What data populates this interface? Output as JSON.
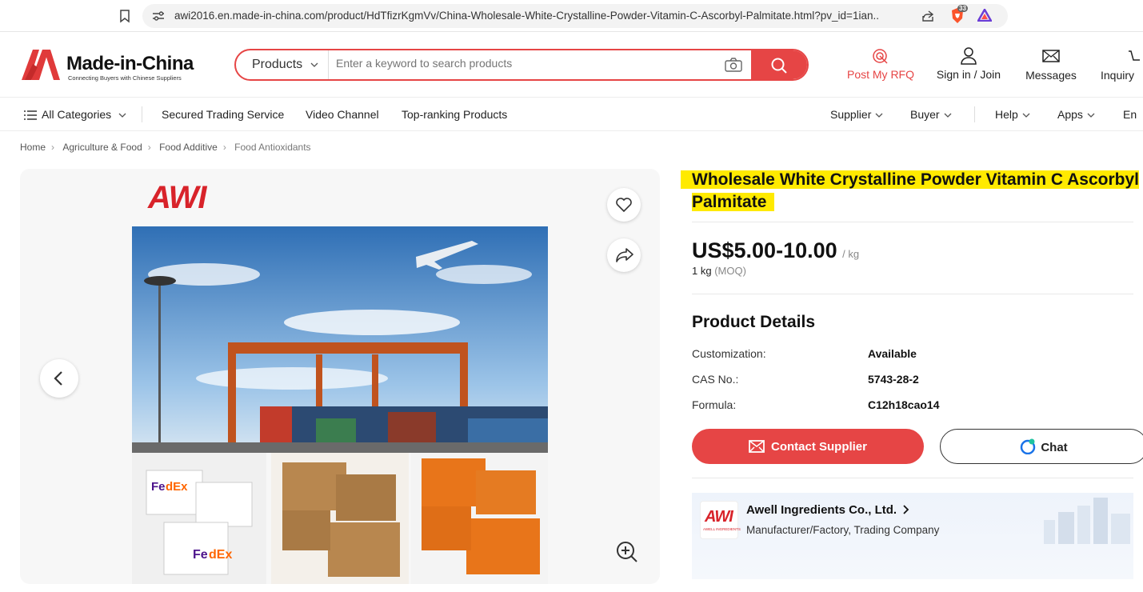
{
  "browser": {
    "url": "awi2016.en.made-in-china.com/product/HdTfizrKgmVv/China-Wholesale-White-Crystalline-Powder-Vitamin-C-Ascorbyl-Palmitate.html?pv_id=1ian...",
    "extension_badge": "33"
  },
  "header": {
    "logo_text": "Made-in-China",
    "logo_tagline": "Connecting Buyers with Chinese Suppliers",
    "search_category": "Products",
    "search_placeholder": "Enter a keyword to search products",
    "post_rfq": "Post My RFQ",
    "sign_in": "Sign in / Join",
    "messages": "Messages",
    "inquiry": "Inquiry"
  },
  "nav": {
    "all_categories": "All Categories",
    "secured": "Secured Trading Service",
    "video": "Video Channel",
    "top_ranking": "Top-ranking Products",
    "supplier": "Supplier",
    "buyer": "Buyer",
    "help": "Help",
    "apps": "Apps",
    "lang": "En"
  },
  "breadcrumb": [
    "Home",
    "Agriculture & Food",
    "Food Additive",
    "Food Antioxidants"
  ],
  "gallery": {
    "brand_logo": "AWI"
  },
  "product": {
    "title": "Wholesale White Crystalline Powder Vitamin C Ascorbyl Palmitate",
    "price": "US$5.00-10.00",
    "unit": "/ kg",
    "moq": "1 kg",
    "moq_label": "(MOQ)",
    "details_heading": "Product Details",
    "details": [
      {
        "key": "Customization:",
        "value": "Available"
      },
      {
        "key": "CAS No.:",
        "value": "5743-28-2"
      },
      {
        "key": "Formula:",
        "value": "C12h18cao14"
      }
    ],
    "contact_label": "Contact Supplier",
    "chat_label": "Chat"
  },
  "company": {
    "name": "Awell Ingredients Co., Ltd.",
    "type": "Manufacturer/Factory, Trading Company",
    "logo_text": "AWI",
    "logo_sub": "AWELL INGREDIENTS"
  },
  "colors": {
    "brand_red": "#e64545",
    "highlight": "#ffea00"
  }
}
